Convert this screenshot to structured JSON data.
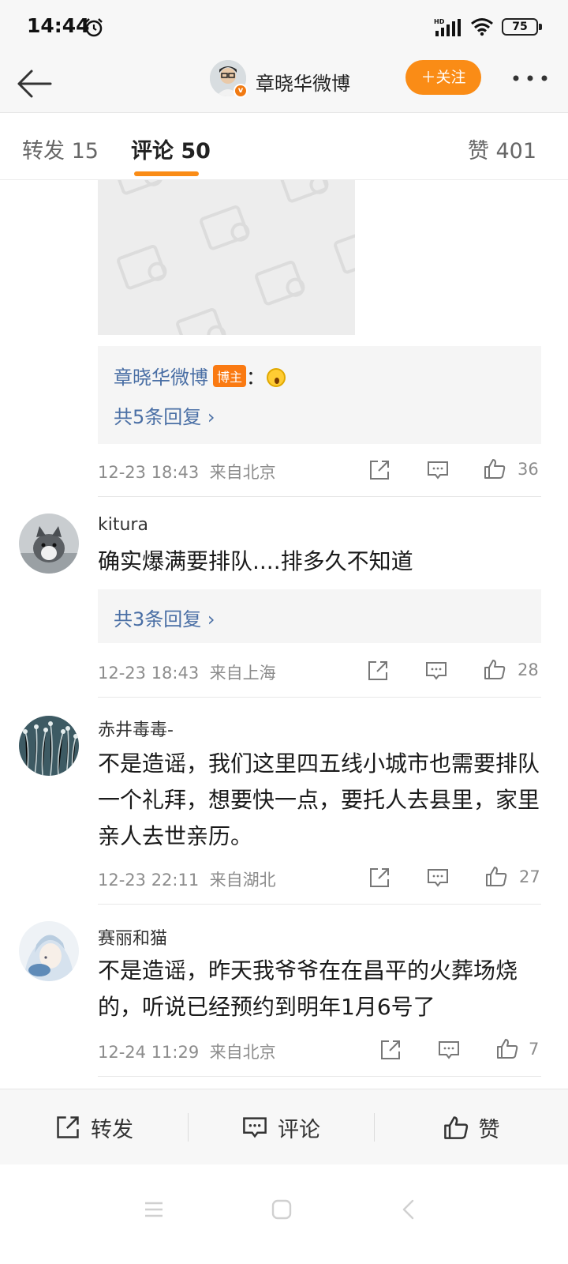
{
  "status_bar": {
    "time": "14:44",
    "battery": "75",
    "icons": [
      "alarm-icon",
      "signal-icon",
      "wifi-icon",
      "battery-icon"
    ]
  },
  "header": {
    "back_icon": "back-arrow-icon",
    "profile_name": "章晓华微博",
    "verified": "v",
    "follow_label": "＋关注",
    "more_icon": "more-dots-icon",
    "accent": "#fa8c16"
  },
  "tabs": {
    "repost_label": "转发 15",
    "comment_label": "评论 50",
    "like_label": "赞 401"
  },
  "top_comment": {
    "reply_author": "章晓华微博",
    "blogger_tag": "博主",
    "reply_colon": "：",
    "reply_count": "共5条回复 ›",
    "time": "12-23 18:43",
    "location": "来自北京",
    "likes": "36"
  },
  "comments": [
    {
      "username": "kitura",
      "text": "确实爆满要排队....排多久不知道",
      "reply_count": "共3条回复 ›",
      "time": "12-23 18:43",
      "location": "来自上海",
      "likes": "28"
    },
    {
      "username": "赤井毒毒-",
      "text": "不是造谣，我们这里四五线小城市也需要排队一个礼拜，想要快一点，要托人去县里，家里亲人去世亲历。",
      "time": "12-23 22:11",
      "location": "来自湖北",
      "likes": "27"
    },
    {
      "username": "赛丽和猫",
      "text": "不是造谣，昨天我爷爷在在昌平的火葬场烧的，听说已经预约到明年1月6号了",
      "time": "12-24 11:29",
      "location": "来自北京",
      "likes": "7"
    }
  ],
  "bottom_bar": {
    "repost_label": "转发",
    "comment_label": "评论",
    "like_label": "赞"
  },
  "colors": {
    "link": "#4a6fa5",
    "meta": "#8c8c8c",
    "reply_bg": "#f5f5f5",
    "blogger_tag": "#fa7a12"
  }
}
